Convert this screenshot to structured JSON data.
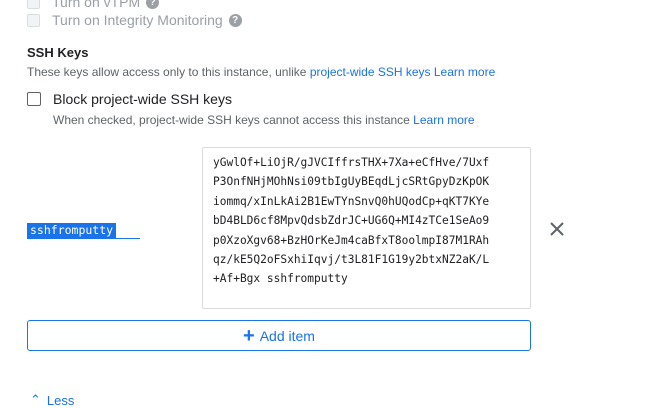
{
  "shielded": {
    "vtpm_label": "Turn on vTPM",
    "integrity_label": "Turn on Integrity Monitoring"
  },
  "ssh": {
    "title": "SSH Keys",
    "description": "These keys allow access only to this instance, unlike ",
    "project_link": "project-wide SSH keys",
    "learn_more": "Learn more",
    "block_label": "Block project-wide SSH keys",
    "block_hint": "When checked, project-wide SSH keys cannot access this instance ",
    "block_learn_more": "Learn more",
    "items": [
      {
        "username": "sshfromputty",
        "key": "yGwlOf+LiOjR/gJVCIffrsTHX+7Xa+eCfHve/7Uxf\nP3OnfNHjMOhNsi09tbIgUyBEqdLjcSRtGpyDzKpOK\niommq/xInLkAi2B1EwTYnSnvQ0hUQodCp+qKT7KYe\nbD4BLD6cf8MpvQdsbZdrJC+UG6Q+MI4zTCe1SeAo9\np0XzoXgv68+BzHOrKeJm4caBfxT8oolmpI87M1RAh\nqz/kE5Q2oFSxhiIqvj/t3L81F1G19y2btxNZ2aK/L\n+Af+Bgx sshfromputty"
      }
    ],
    "add_label": "Add item",
    "less_label": "Less"
  }
}
